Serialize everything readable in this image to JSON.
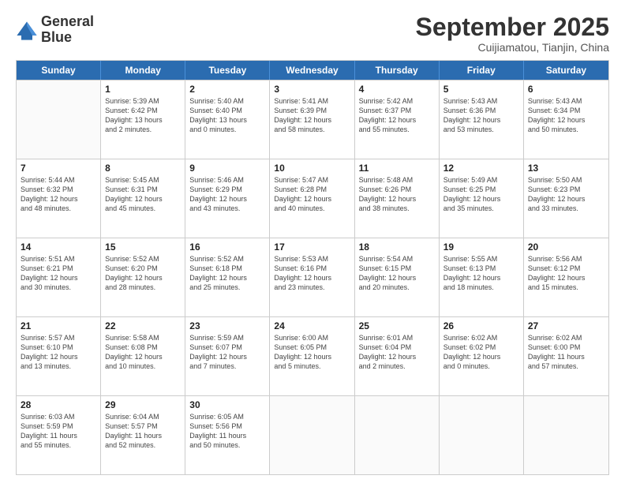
{
  "logo": {
    "line1": "General",
    "line2": "Blue"
  },
  "header": {
    "month": "September 2025",
    "location": "Cuijiamatou, Tianjin, China"
  },
  "days_of_week": [
    "Sunday",
    "Monday",
    "Tuesday",
    "Wednesday",
    "Thursday",
    "Friday",
    "Saturday"
  ],
  "weeks": [
    [
      {
        "day": "",
        "info": ""
      },
      {
        "day": "1",
        "info": "Sunrise: 5:39 AM\nSunset: 6:42 PM\nDaylight: 13 hours\nand 2 minutes."
      },
      {
        "day": "2",
        "info": "Sunrise: 5:40 AM\nSunset: 6:40 PM\nDaylight: 13 hours\nand 0 minutes."
      },
      {
        "day": "3",
        "info": "Sunrise: 5:41 AM\nSunset: 6:39 PM\nDaylight: 12 hours\nand 58 minutes."
      },
      {
        "day": "4",
        "info": "Sunrise: 5:42 AM\nSunset: 6:37 PM\nDaylight: 12 hours\nand 55 minutes."
      },
      {
        "day": "5",
        "info": "Sunrise: 5:43 AM\nSunset: 6:36 PM\nDaylight: 12 hours\nand 53 minutes."
      },
      {
        "day": "6",
        "info": "Sunrise: 5:43 AM\nSunset: 6:34 PM\nDaylight: 12 hours\nand 50 minutes."
      }
    ],
    [
      {
        "day": "7",
        "info": "Sunrise: 5:44 AM\nSunset: 6:32 PM\nDaylight: 12 hours\nand 48 minutes."
      },
      {
        "day": "8",
        "info": "Sunrise: 5:45 AM\nSunset: 6:31 PM\nDaylight: 12 hours\nand 45 minutes."
      },
      {
        "day": "9",
        "info": "Sunrise: 5:46 AM\nSunset: 6:29 PM\nDaylight: 12 hours\nand 43 minutes."
      },
      {
        "day": "10",
        "info": "Sunrise: 5:47 AM\nSunset: 6:28 PM\nDaylight: 12 hours\nand 40 minutes."
      },
      {
        "day": "11",
        "info": "Sunrise: 5:48 AM\nSunset: 6:26 PM\nDaylight: 12 hours\nand 38 minutes."
      },
      {
        "day": "12",
        "info": "Sunrise: 5:49 AM\nSunset: 6:25 PM\nDaylight: 12 hours\nand 35 minutes."
      },
      {
        "day": "13",
        "info": "Sunrise: 5:50 AM\nSunset: 6:23 PM\nDaylight: 12 hours\nand 33 minutes."
      }
    ],
    [
      {
        "day": "14",
        "info": "Sunrise: 5:51 AM\nSunset: 6:21 PM\nDaylight: 12 hours\nand 30 minutes."
      },
      {
        "day": "15",
        "info": "Sunrise: 5:52 AM\nSunset: 6:20 PM\nDaylight: 12 hours\nand 28 minutes."
      },
      {
        "day": "16",
        "info": "Sunrise: 5:52 AM\nSunset: 6:18 PM\nDaylight: 12 hours\nand 25 minutes."
      },
      {
        "day": "17",
        "info": "Sunrise: 5:53 AM\nSunset: 6:16 PM\nDaylight: 12 hours\nand 23 minutes."
      },
      {
        "day": "18",
        "info": "Sunrise: 5:54 AM\nSunset: 6:15 PM\nDaylight: 12 hours\nand 20 minutes."
      },
      {
        "day": "19",
        "info": "Sunrise: 5:55 AM\nSunset: 6:13 PM\nDaylight: 12 hours\nand 18 minutes."
      },
      {
        "day": "20",
        "info": "Sunrise: 5:56 AM\nSunset: 6:12 PM\nDaylight: 12 hours\nand 15 minutes."
      }
    ],
    [
      {
        "day": "21",
        "info": "Sunrise: 5:57 AM\nSunset: 6:10 PM\nDaylight: 12 hours\nand 13 minutes."
      },
      {
        "day": "22",
        "info": "Sunrise: 5:58 AM\nSunset: 6:08 PM\nDaylight: 12 hours\nand 10 minutes."
      },
      {
        "day": "23",
        "info": "Sunrise: 5:59 AM\nSunset: 6:07 PM\nDaylight: 12 hours\nand 7 minutes."
      },
      {
        "day": "24",
        "info": "Sunrise: 6:00 AM\nSunset: 6:05 PM\nDaylight: 12 hours\nand 5 minutes."
      },
      {
        "day": "25",
        "info": "Sunrise: 6:01 AM\nSunset: 6:04 PM\nDaylight: 12 hours\nand 2 minutes."
      },
      {
        "day": "26",
        "info": "Sunrise: 6:02 AM\nSunset: 6:02 PM\nDaylight: 12 hours\nand 0 minutes."
      },
      {
        "day": "27",
        "info": "Sunrise: 6:02 AM\nSunset: 6:00 PM\nDaylight: 11 hours\nand 57 minutes."
      }
    ],
    [
      {
        "day": "28",
        "info": "Sunrise: 6:03 AM\nSunset: 5:59 PM\nDaylight: 11 hours\nand 55 minutes."
      },
      {
        "day": "29",
        "info": "Sunrise: 6:04 AM\nSunset: 5:57 PM\nDaylight: 11 hours\nand 52 minutes."
      },
      {
        "day": "30",
        "info": "Sunrise: 6:05 AM\nSunset: 5:56 PM\nDaylight: 11 hours\nand 50 minutes."
      },
      {
        "day": "",
        "info": ""
      },
      {
        "day": "",
        "info": ""
      },
      {
        "day": "",
        "info": ""
      },
      {
        "day": "",
        "info": ""
      }
    ]
  ]
}
